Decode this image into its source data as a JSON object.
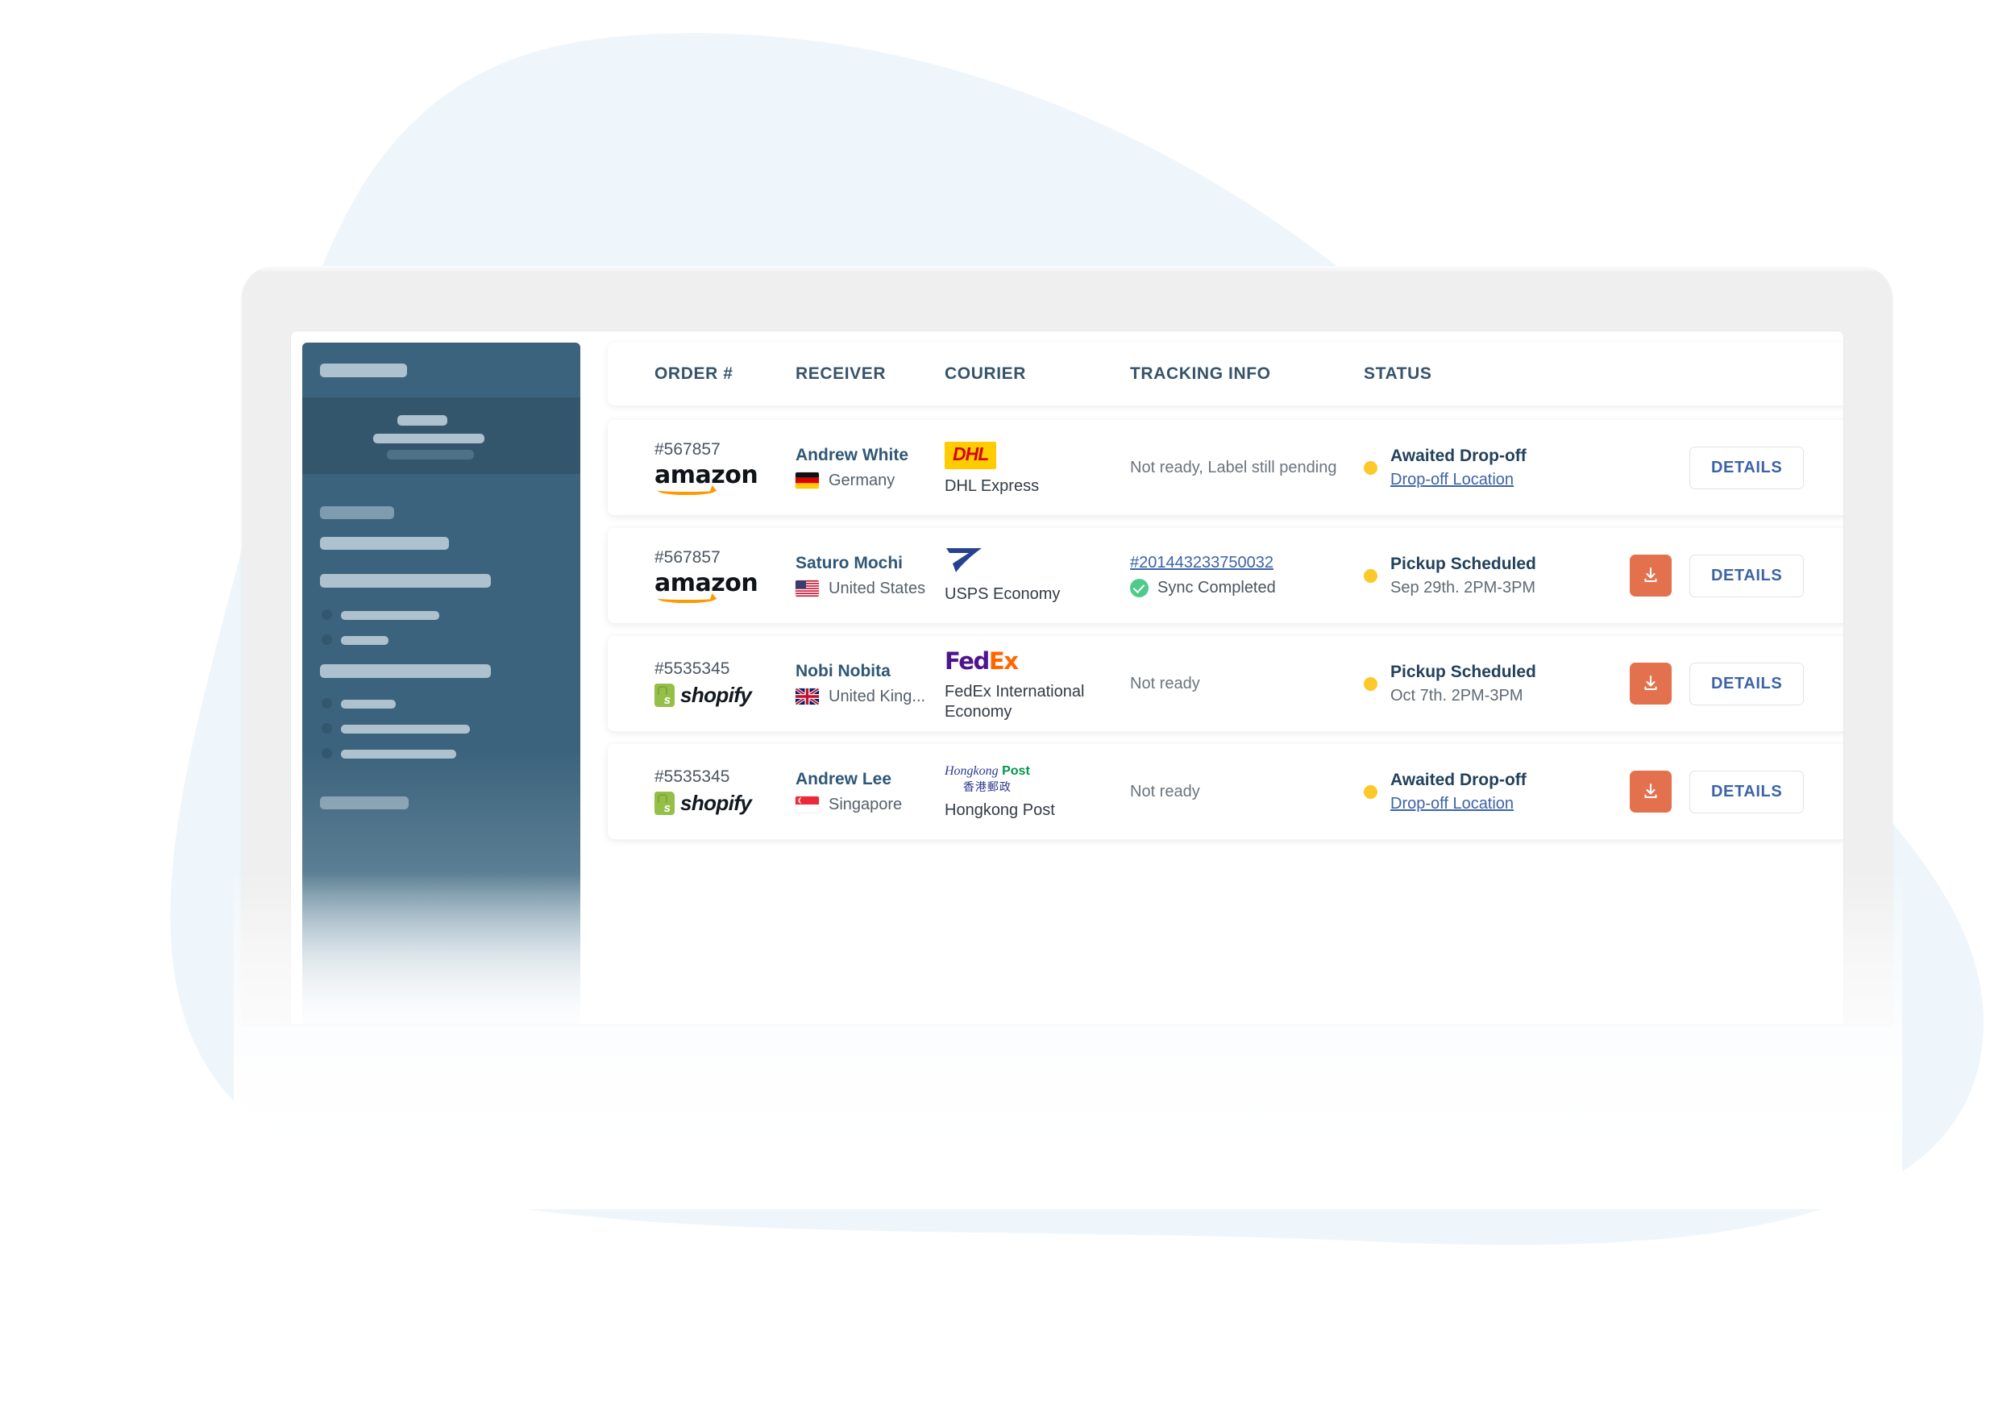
{
  "table": {
    "columns": [
      {
        "key": "order",
        "label": "ORDER #"
      },
      {
        "key": "receiver",
        "label": "RECEIVER"
      },
      {
        "key": "courier",
        "label": "COURIER"
      },
      {
        "key": "tracking",
        "label": "TRACKING INFO"
      },
      {
        "key": "status",
        "label": "STATUS"
      }
    ],
    "rows": [
      {
        "order_no": "#567857",
        "marketplace": "amazon",
        "receiver_name": "Andrew White",
        "country": "Germany",
        "flag": "flag-germany",
        "courier_logo": "dhl-logo",
        "courier_name": "DHL Express",
        "tracking_number": "",
        "tracking_note": "Not ready, Label still pending",
        "sync_text": "",
        "status_title": "Awaited Drop-off",
        "status_sub": "Drop-off Location",
        "status_sub_is_link": true,
        "has_download": false,
        "details_label": "DETAILS"
      },
      {
        "order_no": "#567857",
        "marketplace": "amazon",
        "receiver_name": "Saturo Mochi",
        "country": "United States",
        "flag": "flag-united-states",
        "courier_logo": "usps-logo",
        "courier_name": "USPS Economy",
        "tracking_number": "#201443233750032",
        "tracking_note": "",
        "sync_text": "Sync Completed",
        "status_title": "Pickup Scheduled",
        "status_sub": "Sep 29th. 2PM-3PM",
        "status_sub_is_link": false,
        "has_download": true,
        "details_label": "DETAILS"
      },
      {
        "order_no": "#5535345",
        "marketplace": "shopify",
        "receiver_name": "Nobi Nobita",
        "country": "United King...",
        "flag": "flag-united-kingdom",
        "courier_logo": "fedex-logo",
        "courier_name": "FedEx International Economy",
        "tracking_number": "",
        "tracking_note": "Not ready",
        "sync_text": "",
        "status_title": "Pickup Scheduled",
        "status_sub": "Oct 7th. 2PM-3PM",
        "status_sub_is_link": false,
        "has_download": true,
        "details_label": "DETAILS"
      },
      {
        "order_no": "#5535345",
        "marketplace": "shopify",
        "receiver_name": "Andrew Lee",
        "country": "Singapore",
        "flag": "flag-singapore",
        "courier_logo": "hongkong-post-logo",
        "courier_name": "Hongkong Post",
        "tracking_number": "",
        "tracking_note": "Not ready",
        "sync_text": "",
        "status_title": "Awaited Drop-off",
        "status_sub": "Drop-off Location",
        "status_sub_is_link": true,
        "has_download": true,
        "details_label": "DETAILS"
      }
    ]
  },
  "brands": {
    "amazon_wordmark": "amazon",
    "shopify_wordmark": "shopify",
    "dhl_wordmark": "DHL",
    "fedex_fed": "Fed",
    "fedex_ex": "Ex",
    "hkpost_en_italic": "Hongkong",
    "hkpost_en_bold": "Post",
    "hkpost_zh": "香港郵政"
  },
  "colors": {
    "accent_orange": "#e4714e",
    "link_blue": "#3c63a8",
    "status_pending": "#fdc82a",
    "sync_green": "#4ecb8b",
    "sidebar": "#3c637d",
    "heading": "#36536b",
    "background_blob": "#eff6fb"
  },
  "sidebar": {
    "placeholder_items": 12
  }
}
